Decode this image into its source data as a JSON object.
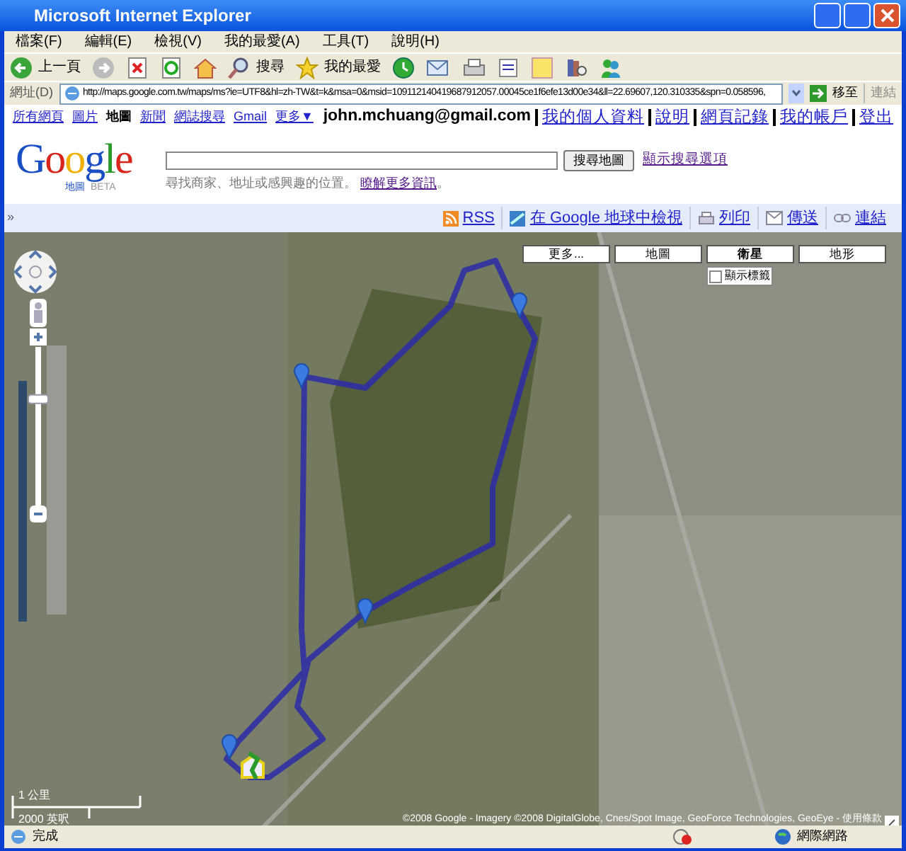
{
  "window": {
    "title": "Microsoft Internet Explorer"
  },
  "menu": [
    "檔案(F)",
    "編輯(E)",
    "檢視(V)",
    "我的最愛(A)",
    "工具(T)",
    "說明(H)"
  ],
  "toolbar": {
    "back": "上一頁",
    "search": "搜尋",
    "favorites": "我的最愛"
  },
  "address_bar": {
    "label": "網址(D)",
    "url": "http://maps.google.com.tw/maps/ms?ie=UTF8&hl=zh-TW&t=k&msa=0&msid=109112140419687912057.00045ce1f6efe13d00e34&ll=22.69607,120.310335&spn=0.058596,",
    "go": "移至",
    "links": "連結"
  },
  "google_nav": [
    {
      "label": "所有網頁",
      "selected": false
    },
    {
      "label": "圖片",
      "selected": false
    },
    {
      "label": "地圖",
      "selected": true
    },
    {
      "label": "新聞",
      "selected": false
    },
    {
      "label": "網誌搜尋",
      "selected": false
    },
    {
      "label": "Gmail",
      "selected": false
    },
    {
      "label": "更多▼",
      "selected": false
    }
  ],
  "account": {
    "email": "john.mchuang@gmail.com",
    "links": [
      "我的個人資料",
      "說明",
      "網頁記錄",
      "我的帳戶",
      "登出"
    ]
  },
  "logo": {
    "text": "Google",
    "sub": "地圖",
    "beta": "BETA"
  },
  "panel_toggle": "»",
  "zoom_slider": {
    "level": 0.68
  },
  "search": {
    "button": "搜尋地圖",
    "options": "顯示搜尋選項",
    "hint": "尋找商家、地址或感興趣的位置。",
    "learn_more": "瞭解更多資訊",
    "hint_end": "。"
  },
  "map_toolbar": [
    {
      "kind": "rss",
      "label": "RSS"
    },
    {
      "kind": "earth",
      "label": "在 Google 地球中檢視"
    },
    {
      "kind": "print",
      "label": "列印"
    },
    {
      "kind": "send",
      "label": "傳送"
    },
    {
      "kind": "link",
      "label": "連結"
    }
  ],
  "map_types": [
    {
      "label": "更多...",
      "selected": false
    },
    {
      "label": "地圖",
      "selected": false
    },
    {
      "label": "衛星",
      "selected": true
    },
    {
      "label": "地形",
      "selected": false
    }
  ],
  "show_labels": {
    "label": "顯示標籤",
    "checked": false
  },
  "scale": {
    "metric": "1 公里",
    "imperial": "2000 英呎"
  },
  "copyright": "©2008 Google - Imagery ©2008 DigitalGlobe, Cnes/Spot Image, GeoForce Technologies, GeoEye - 使用條款",
  "status_bar": {
    "text": "完成",
    "zone": "網際網路"
  }
}
